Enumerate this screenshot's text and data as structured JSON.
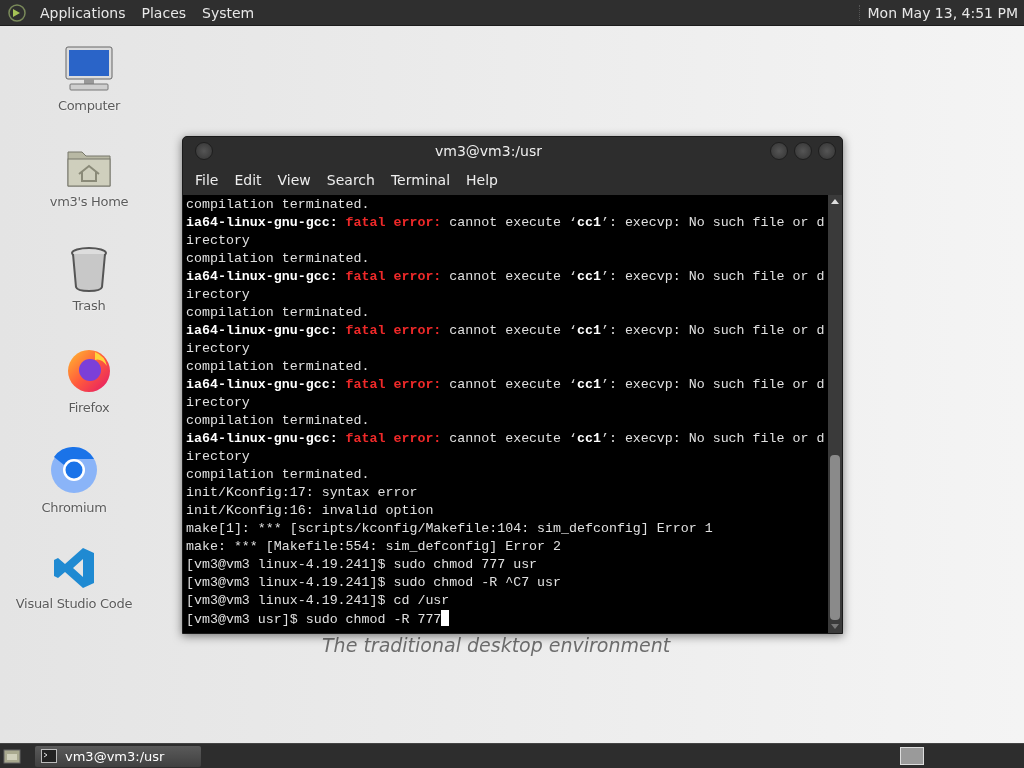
{
  "top_panel": {
    "menus": [
      "Applications",
      "Places",
      "System"
    ],
    "clock": "Mon May 13,  4:51 PM"
  },
  "desktop": {
    "icons": [
      {
        "kind": "computer",
        "label": "Computer"
      },
      {
        "kind": "home",
        "label": "vm3's Home"
      },
      {
        "kind": "trash",
        "label": "Trash"
      },
      {
        "kind": "firefox",
        "label": "Firefox"
      },
      {
        "kind": "chromium",
        "label": "Chromium"
      },
      {
        "kind": "vscode",
        "label": "Visual Studio Code"
      }
    ],
    "background_text": "The traditional desktop environment"
  },
  "terminal": {
    "title": "vm3@vm3:/usr",
    "menu": [
      "File",
      "Edit",
      "View",
      "Search",
      "Terminal",
      "Help"
    ],
    "lines": [
      [
        {
          "kind": "plain",
          "text": "compilation terminated."
        }
      ],
      [
        {
          "kind": "bold",
          "text": "ia64-linux-gnu-gcc: "
        },
        {
          "kind": "error",
          "text": "fatal error: "
        },
        {
          "kind": "plain",
          "text": "cannot execute ‘"
        },
        {
          "kind": "bold",
          "text": "cc1"
        },
        {
          "kind": "plain",
          "text": "’: execvp: No such file or d"
        }
      ],
      [
        {
          "kind": "plain",
          "text": "irectory"
        }
      ],
      [
        {
          "kind": "plain",
          "text": "compilation terminated."
        }
      ],
      [
        {
          "kind": "bold",
          "text": "ia64-linux-gnu-gcc: "
        },
        {
          "kind": "error",
          "text": "fatal error: "
        },
        {
          "kind": "plain",
          "text": "cannot execute ‘"
        },
        {
          "kind": "bold",
          "text": "cc1"
        },
        {
          "kind": "plain",
          "text": "’: execvp: No such file or d"
        }
      ],
      [
        {
          "kind": "plain",
          "text": "irectory"
        }
      ],
      [
        {
          "kind": "plain",
          "text": "compilation terminated."
        }
      ],
      [
        {
          "kind": "bold",
          "text": "ia64-linux-gnu-gcc: "
        },
        {
          "kind": "error",
          "text": "fatal error: "
        },
        {
          "kind": "plain",
          "text": "cannot execute ‘"
        },
        {
          "kind": "bold",
          "text": "cc1"
        },
        {
          "kind": "plain",
          "text": "’: execvp: No such file or d"
        }
      ],
      [
        {
          "kind": "plain",
          "text": "irectory"
        }
      ],
      [
        {
          "kind": "plain",
          "text": "compilation terminated."
        }
      ],
      [
        {
          "kind": "bold",
          "text": "ia64-linux-gnu-gcc: "
        },
        {
          "kind": "error",
          "text": "fatal error: "
        },
        {
          "kind": "plain",
          "text": "cannot execute ‘"
        },
        {
          "kind": "bold",
          "text": "cc1"
        },
        {
          "kind": "plain",
          "text": "’: execvp: No such file or d"
        }
      ],
      [
        {
          "kind": "plain",
          "text": "irectory"
        }
      ],
      [
        {
          "kind": "plain",
          "text": "compilation terminated."
        }
      ],
      [
        {
          "kind": "bold",
          "text": "ia64-linux-gnu-gcc: "
        },
        {
          "kind": "error",
          "text": "fatal error: "
        },
        {
          "kind": "plain",
          "text": "cannot execute ‘"
        },
        {
          "kind": "bold",
          "text": "cc1"
        },
        {
          "kind": "plain",
          "text": "’: execvp: No such file or d"
        }
      ],
      [
        {
          "kind": "plain",
          "text": "irectory"
        }
      ],
      [
        {
          "kind": "plain",
          "text": "compilation terminated."
        }
      ],
      [
        {
          "kind": "plain",
          "text": "init/Kconfig:17: syntax error"
        }
      ],
      [
        {
          "kind": "plain",
          "text": "init/Kconfig:16: invalid option"
        }
      ],
      [
        {
          "kind": "plain",
          "text": "make[1]: *** [scripts/kconfig/Makefile:104: sim_defconfig] Error 1"
        }
      ],
      [
        {
          "kind": "plain",
          "text": "make: *** [Makefile:554: sim_defconfig] Error 2"
        }
      ],
      [
        {
          "kind": "plain",
          "text": "[vm3@vm3 linux-4.19.241]$ sudo chmod 777 usr"
        }
      ],
      [
        {
          "kind": "plain",
          "text": "[vm3@vm3 linux-4.19.241]$ sudo chmod -R ^C7 usr"
        }
      ],
      [
        {
          "kind": "plain",
          "text": "[vm3@vm3 linux-4.19.241]$ cd /usr"
        }
      ],
      [
        {
          "kind": "plain",
          "text": "[vm3@vm3 usr]$ sudo chmod -R 777"
        }
      ]
    ]
  },
  "taskbar": {
    "tasks": [
      {
        "label": "vm3@vm3:/usr",
        "selected": true
      }
    ]
  }
}
